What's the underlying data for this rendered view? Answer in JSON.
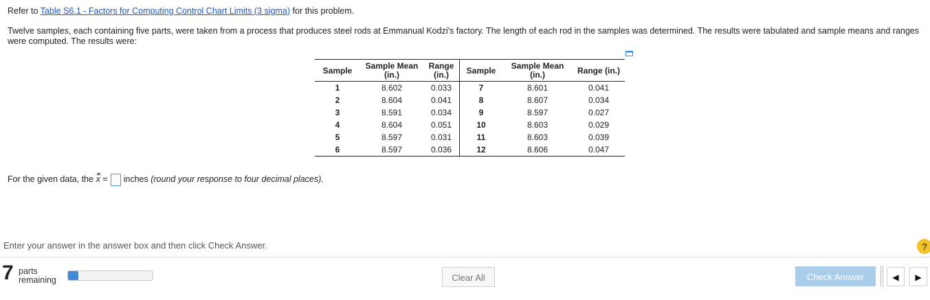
{
  "intro": {
    "prefix": "Refer to ",
    "link": "Table S6.1 - Factors for Computing Control Chart Limits (3 sigma)",
    "suffix": " for this problem."
  },
  "description": "Twelve samples, each containing five parts, were taken from a process that produces steel rods at Emmanual Kodzi's factory. The length of each rod in the samples was determined. The results were tabulated and sample means and ranges were computed. The results were:",
  "table": {
    "headers": [
      "Sample",
      "Sample Mean (in.)",
      "Range (in.)",
      "Sample",
      "Sample Mean (in.)",
      "Range (in.)"
    ],
    "rows": [
      [
        "1",
        "8.602",
        "0.033",
        "7",
        "8.601",
        "0.041"
      ],
      [
        "2",
        "8.604",
        "0.041",
        "8",
        "8.607",
        "0.034"
      ],
      [
        "3",
        "8.591",
        "0.034",
        "9",
        "8.597",
        "0.027"
      ],
      [
        "4",
        "8.604",
        "0.051",
        "10",
        "8.603",
        "0.029"
      ],
      [
        "5",
        "8.597",
        "0.031",
        "11",
        "8.603",
        "0.039"
      ],
      [
        "6",
        "8.597",
        "0.036",
        "12",
        "8.606",
        "0.047"
      ]
    ]
  },
  "question": {
    "prefix": "For the given data, the ",
    "symbol": "x",
    "equals": " =",
    "units": "inches",
    "hint": "(round your response to four decimal places)."
  },
  "instruction": "Enter your answer in the answer box and then click Check Answer.",
  "footer": {
    "parts_count": "7",
    "parts_line1": "parts",
    "parts_line2": "remaining",
    "progress_fraction": 0.12,
    "clear_label": "Clear All",
    "check_label": "Check Answer",
    "help_symbol": "?"
  },
  "colors": {
    "link": "#1a57c7",
    "progress": "#3e8ad8",
    "check_button": "#a9cdeb",
    "help": "#f2c22b"
  }
}
